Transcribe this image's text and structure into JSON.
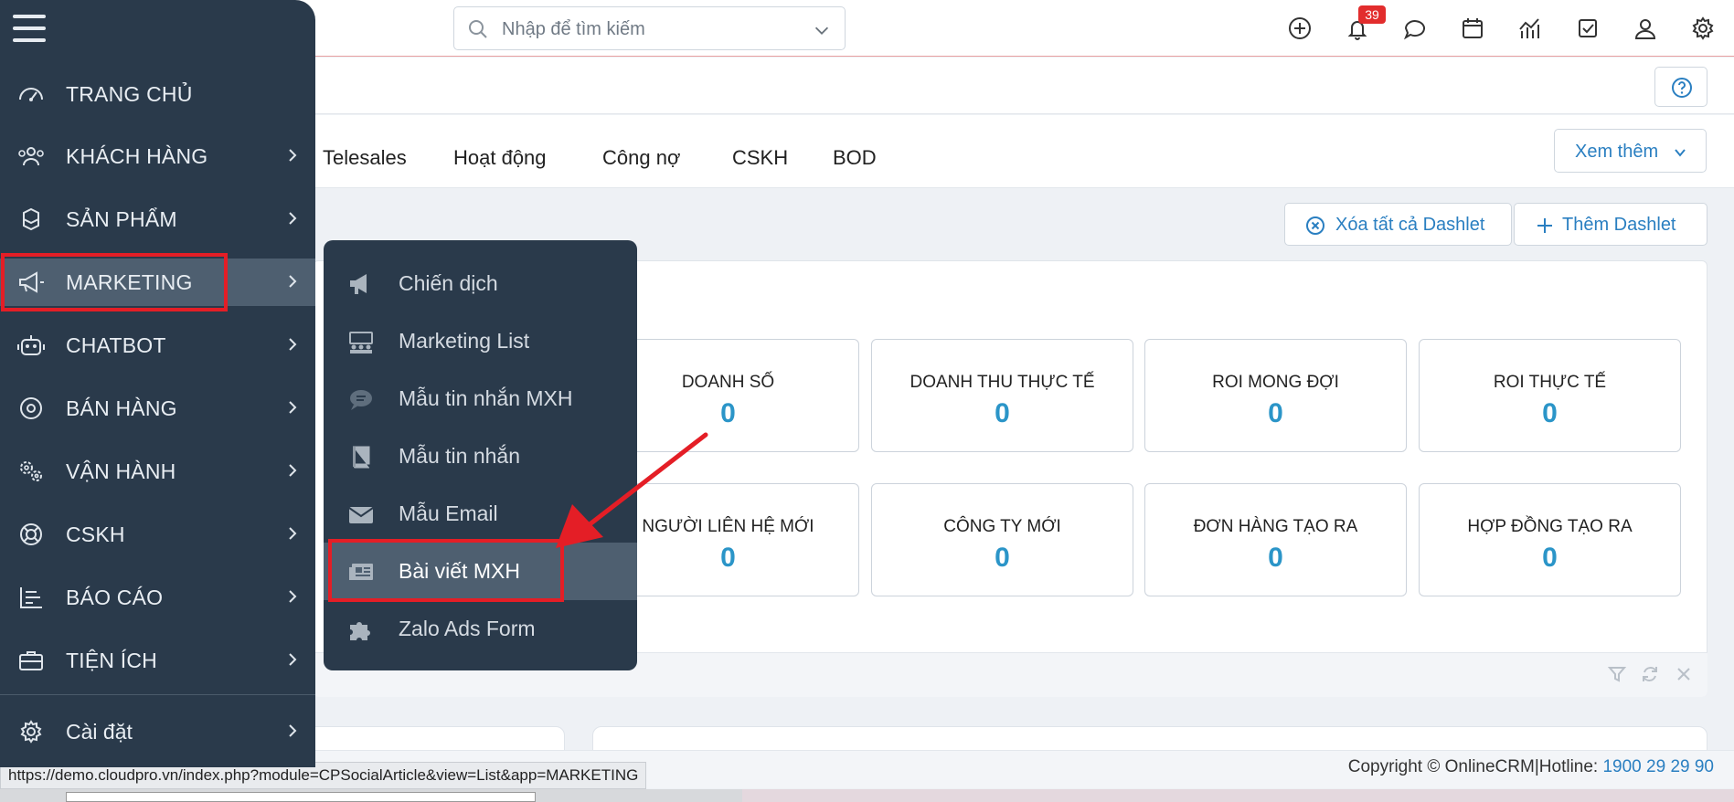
{
  "search": {
    "placeholder": "Nhập để tìm kiếm"
  },
  "notifications": {
    "count": "39"
  },
  "tabs": [
    "Telesales",
    "Hoạt động",
    "Công nợ",
    "CSKH",
    "BOD"
  ],
  "toolbar": {
    "more_label": "Xem thêm",
    "clear_dashlets": "Xóa tất cả Dashlet",
    "add_dashlet": "Thêm Dashlet"
  },
  "stats": [
    {
      "label": "DOANH SỐ",
      "value": "0"
    },
    {
      "label": "DOANH THU THỰC TẾ",
      "value": "0"
    },
    {
      "label": "ROI MONG ĐỢI",
      "value": "0"
    },
    {
      "label": "ROI THỰC TẾ",
      "value": "0"
    },
    {
      "label": "NGƯỜI LIÊN HỆ MỚI",
      "value": "0"
    },
    {
      "label": "CÔNG TY MỚI",
      "value": "0"
    },
    {
      "label": "ĐƠN HÀNG TẠO RA",
      "value": "0"
    },
    {
      "label": "HỢP ĐỒNG TẠO RA",
      "value": "0"
    }
  ],
  "sidebar": {
    "items": [
      {
        "label": "TRANG CHỦ",
        "icon": "dashboard-icon"
      },
      {
        "label": "KHÁCH HÀNG",
        "icon": "users-icon"
      },
      {
        "label": "SẢN PHẨM",
        "icon": "cubes-icon"
      },
      {
        "label": "MARKETING",
        "icon": "megaphone-icon"
      },
      {
        "label": "CHATBOT",
        "icon": "robot-icon"
      },
      {
        "label": "BÁN HÀNG",
        "icon": "target-icon"
      },
      {
        "label": "VẬN HÀNH",
        "icon": "gears-icon"
      },
      {
        "label": "CSKH",
        "icon": "lifebuoy-icon"
      },
      {
        "label": "BÁO CÁO",
        "icon": "report-icon"
      },
      {
        "label": "TIỆN ÍCH",
        "icon": "briefcase-icon"
      },
      {
        "label": "Cài đặt",
        "icon": "gear-icon"
      }
    ]
  },
  "submenu": {
    "items": [
      {
        "label": "Chiến dịch",
        "icon": "megaphone-icon"
      },
      {
        "label": "Marketing List",
        "icon": "group-icon"
      },
      {
        "label": "Mẫu tin nhắn MXH",
        "icon": "chat-bubble-icon"
      },
      {
        "label": "Mẫu tin nhắn",
        "icon": "book-icon"
      },
      {
        "label": "Mẫu Email",
        "icon": "envelope-icon"
      },
      {
        "label": "Bài viết MXH",
        "icon": "newspaper-icon"
      },
      {
        "label": "Zalo Ads Form",
        "icon": "puzzle-icon"
      }
    ]
  },
  "footer": {
    "copyright": "Copyright © OnlineCRM",
    "separator": "|",
    "hotline_label": "Hotline: ",
    "hotline": "1900 29 29 90",
    "status_url": "https://demo.cloudpro.vn/index.php?module=CPSocialArticle&view=List&app=MARKETING"
  },
  "colors": {
    "sidebar_bg": "#2a3a4b",
    "accent": "#2a7fc1",
    "stat_value": "#2b95c8",
    "highlight": "#e41e26",
    "badge": "#e22d2d"
  }
}
